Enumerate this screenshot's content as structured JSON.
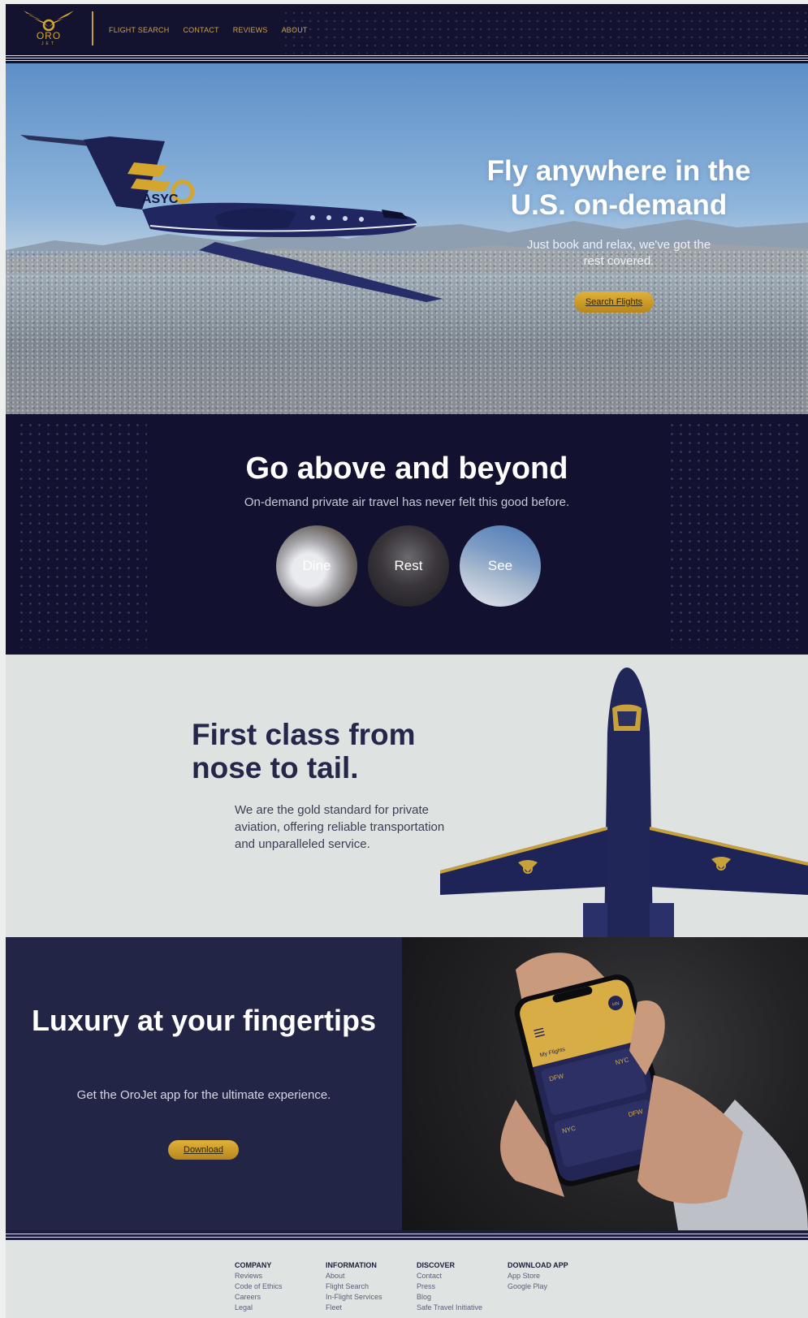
{
  "nav": {
    "logo_text": "ORO",
    "logo_sub": "JET",
    "links": [
      "FLIGHT SEARCH",
      "CONTACT",
      "REVIEWS",
      "ABOUT"
    ]
  },
  "hero": {
    "title": "Fly anywhere in the U.S. on-demand",
    "subtitle": "Just book and relax, we've got the rest covered.",
    "button": "Search Flights",
    "tail_mark": "ASYC"
  },
  "above": {
    "title": "Go above and beyond",
    "subtitle": "On-demand private air travel has never felt this good before.",
    "circles": [
      "Dine",
      "Rest",
      "See"
    ]
  },
  "first_class": {
    "title": "First class from nose to tail.",
    "text": "We are the gold standard for private aviation, offering reliable transportation and unparalleled service."
  },
  "app": {
    "title": "Luxury at your fingertips",
    "text": "Get the OroJet app for the ultimate experience.",
    "button": "Download",
    "phone": {
      "header": "My Flights",
      "avatar": "HN",
      "cards": [
        {
          "from": "DFW",
          "to": "NYC"
        },
        {
          "from": "NYC",
          "to": "DFW"
        }
      ]
    }
  },
  "footer": {
    "columns": [
      {
        "title": "COMPANY",
        "links": [
          "Reviews",
          "Code of Ethics",
          "Careers",
          "Legal"
        ]
      },
      {
        "title": "INFORMATION",
        "links": [
          "About",
          "Flight Search",
          "In-Flight Services",
          "Fleet"
        ]
      },
      {
        "title": "DISCOVER",
        "links": [
          "Contact",
          "Press",
          "Blog",
          "Safe Travel Initiative"
        ]
      },
      {
        "title": "DOWNLOAD APP",
        "links": [
          "App Store",
          "Google Play"
        ]
      }
    ]
  },
  "colors": {
    "navy": "#13122f",
    "gold": "#d4a62e",
    "panel": "#222546",
    "light": "#dee2e0"
  }
}
